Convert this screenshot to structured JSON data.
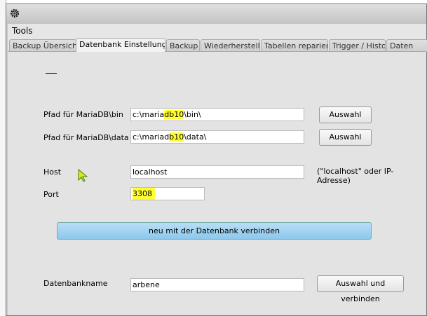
{
  "menu": {
    "tools": "Tools"
  },
  "tabs": [
    "Backup Übersicht",
    "Datenbank Einstellungen",
    "Backup",
    "Wiederherstellen",
    "Tabellen reparieren",
    "Trigger / Historie",
    "Daten"
  ],
  "form": {
    "bin_label": "Pfad für MariaDB\\bin",
    "bin_value_a": "c:\\maria",
    "bin_value_hl": "db10",
    "bin_value_b": "\\bin\\",
    "data_label": "Pfad für MariaDB\\data",
    "data_value_a": "c:\\mariad",
    "data_value_hl": "b10",
    "data_value_b": "\\data\\",
    "choose_label": "Auswahl",
    "host_label": "Host",
    "host_value": "localhost",
    "host_hint": "(\"localhost\" oder IP-Adresse)",
    "port_label": "Port",
    "port_value": "3308",
    "reconnect_label": "neu mit der Datenbank verbinden",
    "dbname_label": "Datenbankname",
    "dbname_value": "arbene",
    "choose_connect_label": "Auswahl und verbinden"
  },
  "colors": {
    "highlight": "#ffff33",
    "primary_button": "#9fd2f0"
  }
}
